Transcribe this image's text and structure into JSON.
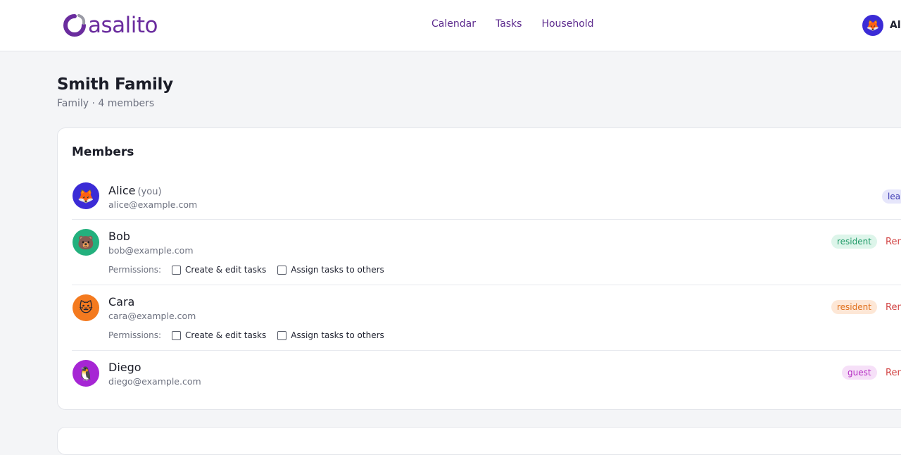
{
  "header": {
    "logo_text": "asalito",
    "nav": [
      {
        "label": "Calendar"
      },
      {
        "label": "Tasks"
      },
      {
        "label": "Household"
      }
    ],
    "user_avatar": "🦊",
    "user_name": "Ali"
  },
  "household": {
    "name": "Smith Family",
    "type": "Family",
    "members_count": "4 members"
  },
  "members_card": {
    "title": "Members",
    "permissions_label": "Permissions:",
    "perm_create": "Create & edit tasks",
    "perm_assign": "Assign tasks to others",
    "remove_label": "Ren",
    "members": [
      {
        "name": "Alice",
        "you": "(you)",
        "email": "alice@example.com",
        "avatar": "🦊",
        "avatar_color": "#3b2bd6",
        "role": "lea",
        "role_bg": "#e6e6fb",
        "role_color": "#3d3ab3"
      },
      {
        "name": "Bob",
        "email": "bob@example.com",
        "avatar": "🐻",
        "avatar_color": "#23b07d",
        "role": "resident",
        "role_bg": "#ddf5ea",
        "role_color": "#1f9a68"
      },
      {
        "name": "Cara",
        "email": "cara@example.com",
        "avatar": "🐱",
        "avatar_color": "#f47a1f",
        "role": "resident",
        "role_bg": "#fde7d6",
        "role_color": "#e0701c"
      },
      {
        "name": "Diego",
        "email": "diego@example.com",
        "avatar": "🐧",
        "avatar_color": "#a626d4",
        "role": "guest",
        "role_bg": "#f6e0f8",
        "role_color": "#b42bc2"
      }
    ]
  },
  "colors": {
    "brand": "#6a2c9e",
    "nav": "#5d2b8e",
    "remove": "#d24545"
  }
}
